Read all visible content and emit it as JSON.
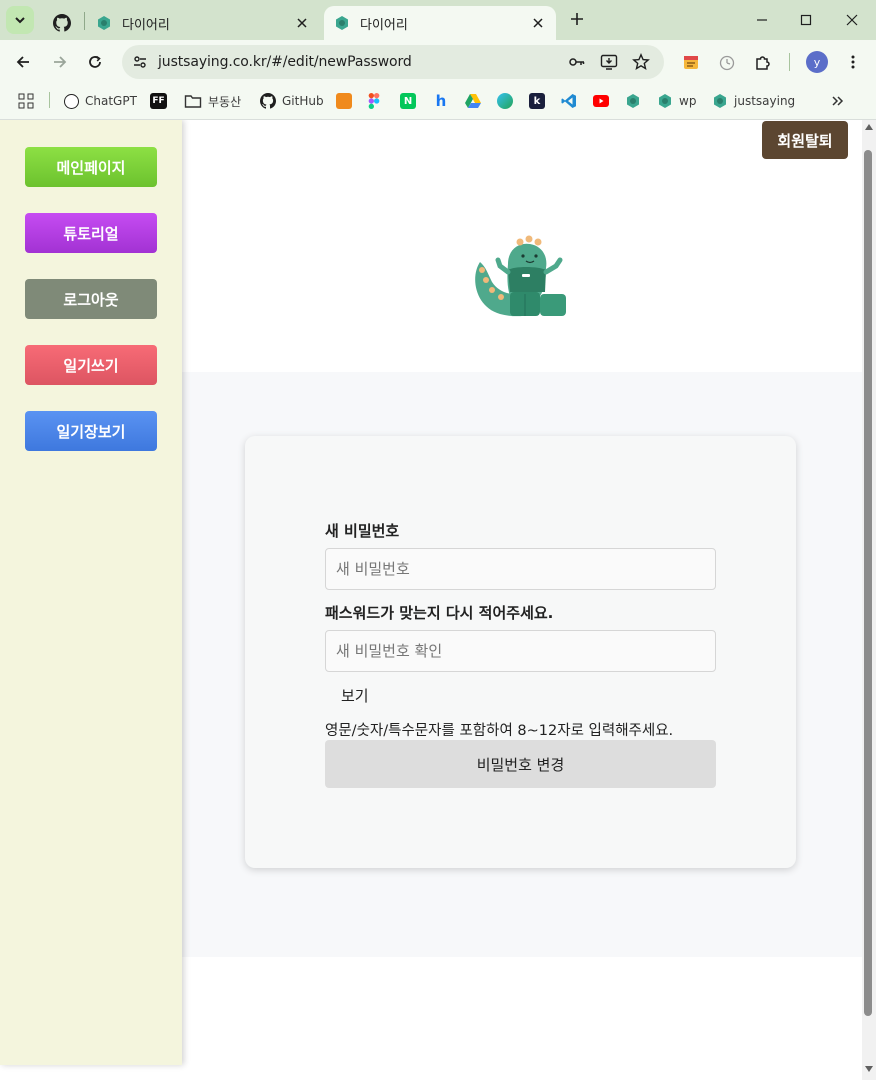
{
  "browser": {
    "tabs": [
      {
        "title": "다이어리"
      },
      {
        "title": "다이어리"
      }
    ],
    "url": "justsaying.co.kr/#/edit/newPassword",
    "profile_initial": "y",
    "bookmarks": [
      {
        "label": "ChatGPT"
      },
      {
        "label": "부동산"
      },
      {
        "label": "GitHub"
      },
      {
        "label": "wp"
      },
      {
        "label": "justsaying"
      }
    ],
    "bookmark_icon_letters": {
      "ff": "FF",
      "naver": "N",
      "h": "h",
      "k": "k"
    }
  },
  "sidebar": {
    "main": "메인페이지",
    "tutorial": "튜토리얼",
    "logout": "로그아웃",
    "write": "일기쓰기",
    "list": "일기장보기"
  },
  "header": {
    "withdraw": "회원탈퇴"
  },
  "form": {
    "new_password_label": "새 비밀번호",
    "new_password_placeholder": "새 비밀번호",
    "confirm_label": "패스워드가 맞는지 다시 적어주세요.",
    "confirm_placeholder": "새 비밀번호 확인",
    "show_toggle": "보기",
    "hint": "영문/숫자/특수문자를 포함하여 8~12자로 입력해주세요.",
    "submit": "비밀번호 변경"
  },
  "colors": {
    "main_btn": "#7cd13a",
    "tutorial_btn": "#b43fe4",
    "logout_btn": "#7f8a78",
    "write_btn": "#ec606c",
    "list_btn": "#4c86ea",
    "withdraw_btn": "#5c4631",
    "sidebar_bg": "#f4f5dd"
  }
}
